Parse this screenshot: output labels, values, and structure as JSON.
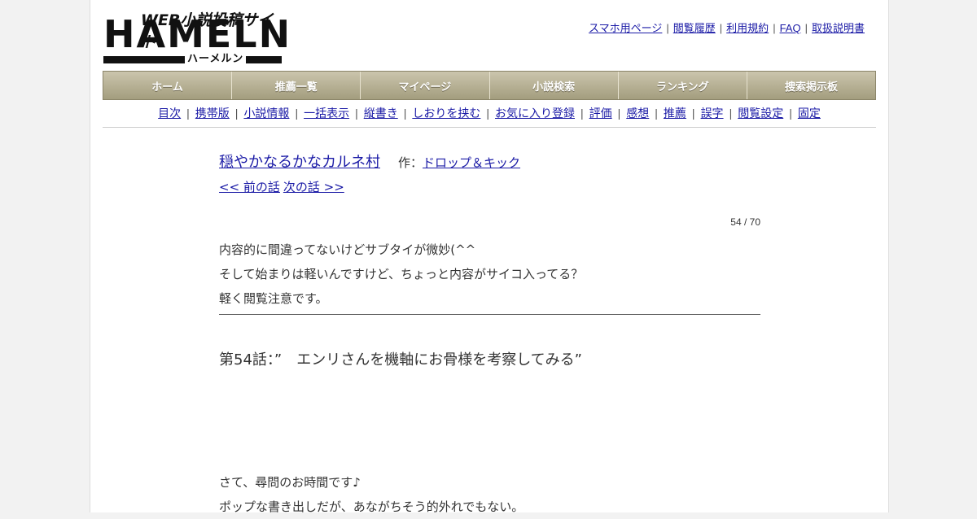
{
  "logo": {
    "tagline": "WEB小説投稿サイト",
    "name": "HAMELN",
    "kana": "ハーメルン"
  },
  "header_links": [
    "スマホ用ページ",
    "閲覧履歴",
    "利用規約",
    "FAQ",
    "取扱説明書"
  ],
  "nav": [
    "ホーム",
    "推薦一覧",
    "マイページ",
    "小説検索",
    "ランキング",
    "捜索掲示板"
  ],
  "subnav": [
    "目次",
    "携帯版",
    "小説情報",
    "一括表示",
    "縦書き",
    "しおりを挟む",
    "お気に入り登録",
    "評価",
    "感想",
    "推薦",
    "誤字",
    "閲覧設定",
    "固定"
  ],
  "novel": {
    "title": "穏やかなるかなカルネ村",
    "author_prefix": "作：",
    "author": "ドロップ＆キック",
    "prev": "<< 前の話",
    "next": "次の話 >>",
    "page_count": "54 / 70"
  },
  "preface": [
    "内容的に間違ってないけどサブタイが微妙(^^",
    "そして始まりは軽いんですけど、ちょっと内容がサイコ入ってる？",
    "軽く閲覧注意です。"
  ],
  "chapter_title": "第54話：”　エンリさんを機軸にお骨様を考察してみる”",
  "body": [
    "さて、尋問のお時間です♪",
    "ポップな書き出しだが、あながちそう的外れでもない。"
  ],
  "colors": {
    "link": "#1a1aa6",
    "nav_top": "#cbc5ad",
    "nav_bottom": "#a39d7e"
  }
}
